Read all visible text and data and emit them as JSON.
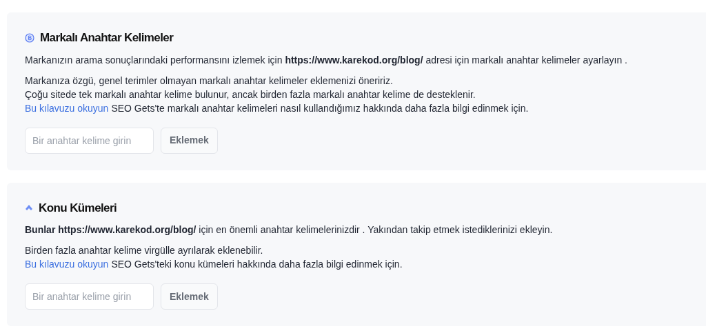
{
  "sections": [
    {
      "kind": "brand",
      "title": "Markalı Anahtar Kelimeler",
      "intro": "Markanızın arama sonuçlarındaki performansını izlemek için **https://www.karekod.org/blog/** adresi için markalı anahtar kelimeler ayarlayın .",
      "lines": [
        "Markanıza özgü, genel terimler olmayan markalı anahtar kelimeler eklemenizi öneririz.",
        "Çoğu sitede tek markalı anahtar kelime bulunur, ancak birden fazla markalı anahtar kelime de desteklenir."
      ],
      "guide_link": "Bu kılavuzu okuyun",
      "guide_text": "SEO Gets'te markalı anahtar kelimeleri nasıl kullandığımız hakkında daha fazla bilgi edinmek için.",
      "placeholder": "Bir anahtar kelime girin",
      "button": "Eklemek"
    },
    {
      "kind": "topic",
      "title": "Konu Kümeleri",
      "intro": "**Bunlar https://www.karekod.org/blog/** için en önemli anahtar kelimelerinizdir . Yakından takip etmek istediklerinizi ekleyin.",
      "lines": [
        "Birden fazla anahtar kelime virgülle ayrılarak eklenebilir."
      ],
      "guide_link": "Bu kılavuzu okuyun",
      "guide_text": "SEO Gets'teki konu kümeleri hakkında daha fazla bilgi edinmek için.",
      "placeholder": "Bir anahtar kelime girin",
      "button": "Eklemek"
    }
  ]
}
